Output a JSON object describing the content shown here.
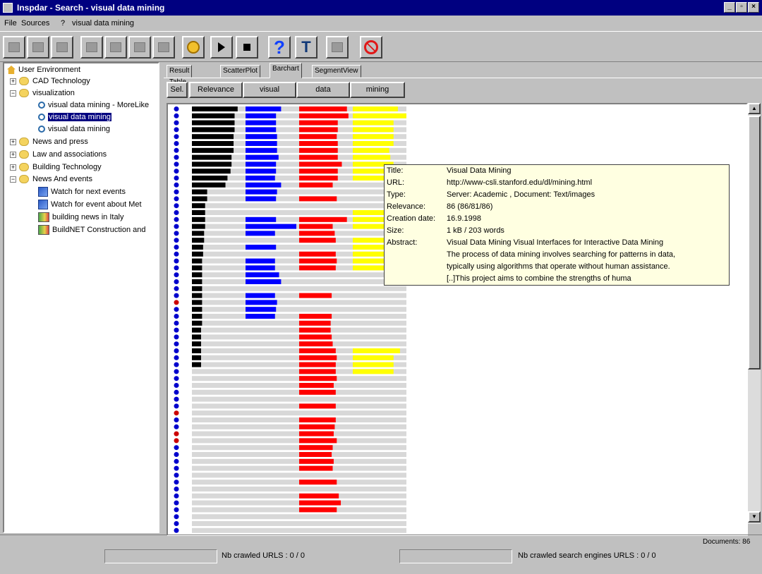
{
  "window": {
    "title": "Inspdar - Search - visual data mining"
  },
  "menu": {
    "file": "File",
    "sources": "Sources",
    "help": "?",
    "query": "visual data mining"
  },
  "tree": {
    "root": "User Environment",
    "items": [
      "CAD Technology",
      "visualization",
      "visual data mining - MoreLike",
      "visual data mining",
      "visual data mining",
      "News and press",
      "Law and associations",
      "Building Technology",
      "News And events",
      "Watch for next events",
      "Watch for event about Met",
      "building news in Italy",
      "BuildNET Construction and"
    ]
  },
  "tabs": [
    "Result Table",
    "ScatterPlot",
    "Barchart",
    "SegmentView"
  ],
  "columns": {
    "sel": "Sel.",
    "relevance": "Relevance",
    "visual": "visual",
    "data": "data",
    "mining": "mining"
  },
  "tooltip": {
    "title_key": "Title:",
    "title": "Visual Data Mining",
    "url_key": "URL:",
    "url": "http://www-csli.stanford.edu/dl/mining.html",
    "type_key": "Type:",
    "type": "Server: Academic , Document: Text/images",
    "relevance_key": "Relevance:",
    "relevance": "86 (86/81/86)",
    "date_key": "Creation date:",
    "date": "16.9.1998",
    "size_key": "Size:",
    "size": "1 kB / 203 words",
    "abstract_key": "Abstract:",
    "abstract_1": "Visual Data Mining Visual Interfaces for Interactive Data Mining",
    "abstract_2": "The process of data mining involves searching for patterns in data,",
    "abstract_3": "typically using algorithms that operate without human assistance.",
    "abstract_4": "[..]This project aims to combine the strengths of huma"
  },
  "documents_label": "Documents: 86",
  "status": {
    "crawled_urls": "Nb crawled URLS : 0 / 0",
    "crawled_search": "Nb crawled search engines URLS : 0 / 0"
  },
  "colors": {
    "relevance": "#000000",
    "visual": "#0000ff",
    "data": "#ff0000",
    "mining": "#ffff00",
    "dot": "#0000cc",
    "dot_alt": "#cc0000"
  },
  "chart_data": {
    "type": "bar",
    "series_names": [
      "Relevance",
      "visual",
      "data",
      "mining"
    ],
    "rows": 62,
    "relevance": [
      0.9,
      0.84,
      0.84,
      0.84,
      0.82,
      0.82,
      0.82,
      0.78,
      0.78,
      0.76,
      0.7,
      0.66,
      0.3,
      0.3,
      0.26,
      0.26,
      0.26,
      0.26,
      0.24,
      0.24,
      0.22,
      0.22,
      0.2,
      0.2,
      0.2,
      0.2,
      0.2,
      0.2,
      0.2,
      0.2,
      0.2,
      0.2,
      0.18,
      0.18,
      0.18,
      0.18,
      0.18,
      0.18,
      0,
      0,
      0,
      0,
      0,
      0,
      0,
      0,
      0,
      0,
      0,
      0,
      0,
      0,
      0,
      0,
      0,
      0,
      0,
      0,
      0,
      0,
      0,
      0
    ],
    "visual": [
      0.7,
      0.6,
      0.6,
      0.6,
      0.62,
      0.62,
      0.62,
      0.65,
      0.6,
      0.6,
      0.58,
      0.7,
      0.62,
      0.6,
      0,
      0,
      0.6,
      1,
      0.58,
      0,
      0.6,
      0,
      0.58,
      0.58,
      0.66,
      0.7,
      0,
      0.58,
      0.62,
      0.6,
      0.58,
      0,
      0,
      0,
      0,
      0,
      0,
      0,
      0,
      0,
      0,
      0,
      0,
      0,
      0,
      0,
      0,
      0,
      0,
      0,
      0,
      0,
      0,
      0,
      0,
      0,
      0,
      0,
      0,
      0,
      0,
      0
    ],
    "data": [
      0.94,
      0.97,
      0.76,
      0.76,
      0.74,
      0.76,
      0.76,
      0.76,
      0.84,
      0.76,
      0.76,
      0.66,
      0,
      0.74,
      0,
      0,
      0.94,
      0.66,
      0.7,
      0.72,
      0,
      0.72,
      0.74,
      0.72,
      0,
      0,
      0,
      0.64,
      0,
      0,
      0.64,
      0.62,
      0.62,
      0.64,
      0.66,
      0.72,
      0.74,
      0.72,
      0.72,
      0.74,
      0.68,
      0.72,
      0,
      0.72,
      0,
      0.72,
      0.7,
      0.68,
      0.74,
      0.66,
      0.64,
      0.68,
      0.66,
      0,
      0.74,
      0,
      0.78,
      0.82,
      0.74,
      0,
      0,
      0
    ],
    "mining": [
      0.84,
      1,
      0.76,
      0.76,
      0.76,
      0.76,
      0.68,
      0.7,
      0.76,
      0.8,
      0.66,
      0,
      0,
      0,
      0,
      0.8,
      0.8,
      0.8,
      0,
      0.76,
      0.76,
      0.76,
      0.76,
      0.74,
      0,
      0,
      0,
      0,
      0,
      0,
      0,
      0,
      0,
      0,
      0,
      0.88,
      0.76,
      0.76,
      0.76,
      0,
      0,
      0,
      0,
      0,
      0,
      0,
      0,
      0,
      0,
      0,
      0,
      0,
      0,
      0,
      0,
      0,
      0,
      0,
      0,
      0,
      0,
      0
    ],
    "dot_highlight_rows": [
      28,
      44,
      47,
      48
    ]
  }
}
